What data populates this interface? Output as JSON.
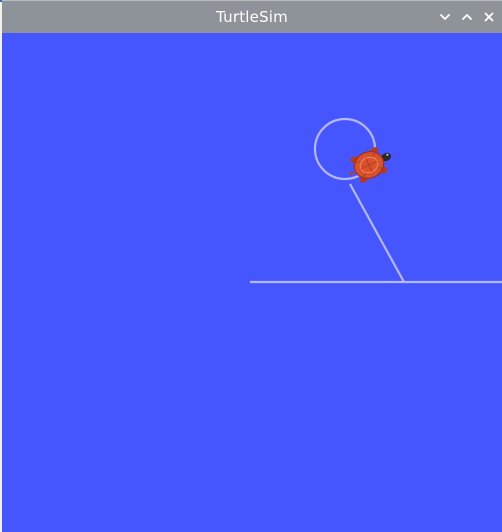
{
  "window": {
    "title": "TurtleSim",
    "controls": [
      "minimize",
      "maximize",
      "close"
    ]
  },
  "colors": {
    "background": "#4556ff",
    "pen": "#b3b8ff",
    "titlebar": "#8d9399",
    "turtle_shell": "#d9502c"
  },
  "icons": {
    "minimize": "chevron-down-icon",
    "maximize": "chevron-up-icon",
    "close": "close-icon",
    "turtle": "turtle-icon"
  }
}
